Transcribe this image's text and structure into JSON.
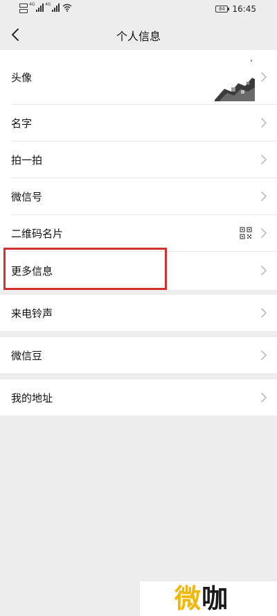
{
  "status_bar": {
    "time": "16:45",
    "battery": "84",
    "network_1": "4G",
    "network_2": "4G"
  },
  "nav": {
    "title": "个人信息"
  },
  "rows": {
    "avatar_label": "头像",
    "name_label": "名字",
    "pai_label": "拍一拍",
    "wechat_id_label": "微信号",
    "qrcode_label": "二维码名片",
    "more_info_label": "更多信息",
    "ringtone_label": "来电铃声",
    "beans_label": "微信豆",
    "address_label": "我的地址"
  },
  "highlight": {
    "color": "#d32f2f",
    "target": "更多信息"
  },
  "watermark": {
    "first_char": "微",
    "second_char": "咖"
  },
  "colors": {
    "background": "#ededed",
    "card": "#ffffff",
    "highlight": "#d32f2f",
    "chevron": "#b2b2b2"
  },
  "icons": {
    "back": "chevron-left-icon",
    "row_arrow": "chevron-right-icon",
    "qrcode": "qrcode-icon",
    "wifi": "wifi-icon",
    "battery": "battery-icon"
  }
}
